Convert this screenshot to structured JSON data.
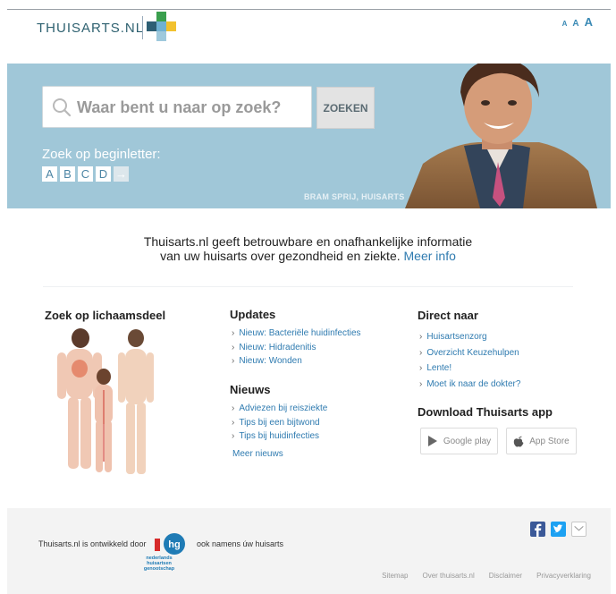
{
  "header": {
    "logo_text": "THUISARTS.NL",
    "font_sizes": [
      "A",
      "A",
      "A"
    ]
  },
  "hero": {
    "search_placeholder": "Waar bent u naar op zoek?",
    "search_button": "ZOEKEN",
    "letter_label": "Zoek op beginletter:",
    "letters": [
      "A",
      "B",
      "C",
      "D"
    ],
    "letter_arrow": "→",
    "caption": "BRAM SPRIJ, HUISARTS"
  },
  "intro": {
    "line1": "Thuisarts.nl geeft betrouwbare en onafhankelijke informatie",
    "line2": "van uw huisarts over gezondheid en ziekte.",
    "more_info": "Meer info"
  },
  "body_column": {
    "title": "Zoek op lichaamsdeel"
  },
  "updates": {
    "title": "Updates",
    "items": [
      "Nieuw: Bacteriële huidinfecties",
      "Nieuw: Hidradenitis",
      "Nieuw: Wonden"
    ]
  },
  "news": {
    "title": "Nieuws",
    "items": [
      "Adviezen bij reisziekte",
      "Tips bij een bijtwond",
      "Tips bij huidinfecties"
    ],
    "more": "Meer nieuws"
  },
  "direct": {
    "title": "Direct naar",
    "items": [
      "Huisartsenzorg",
      "Overzicht Keuzehulpen",
      "Lente!",
      "Moet ik naar de dokter?"
    ]
  },
  "app": {
    "title": "Download Thuisarts app",
    "google_play": "Google play",
    "app_store": "App Store"
  },
  "footer": {
    "developed_by": "Thuisarts.nl is ontwikkeld door",
    "on_behalf": "ook namens úw huisarts",
    "nhg_line1": "nederlands huisartsen",
    "nhg_line2": "genootschap",
    "links": [
      "Sitemap",
      "Over thuisarts.nl",
      "Disclaimer",
      "Privacyverklaring"
    ]
  },
  "colors": {
    "hero_bg": "#a0c7d8",
    "link": "#2f7bb0",
    "facebook": "#3b5998",
    "twitter": "#1da1f2"
  }
}
